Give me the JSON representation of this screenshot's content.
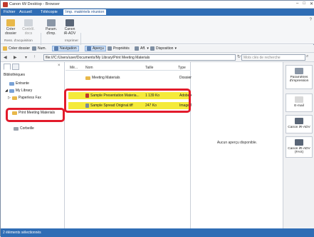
{
  "window": {
    "title": "Canon iW Desktop - Browser"
  },
  "menu": {
    "items": [
      "Fichier",
      "Accueil",
      "Télécopie"
    ],
    "active": "Imp. matériels réunion"
  },
  "ribbon": {
    "create_folder": "Créer dossier",
    "check_docs": "Contrôl. docs",
    "group1": "Ress. d'acquisition",
    "print_settings": "Param. d'imp.",
    "canon_printer": "Canon iR-ADV",
    "group2": "Imprimer"
  },
  "toolbar": {
    "create_folder": "Créer dossier",
    "num": "Num.",
    "navigation": "Navigation",
    "preview": "Aperçu",
    "properties": "Propriétés",
    "display": "Aff.",
    "layout": "Disposition"
  },
  "address": {
    "path": "file:///C:/Users/user/Documents/My Library/Print Meeting Materials",
    "search_placeholder": "Mots clés de recherche"
  },
  "tree": {
    "heading": "Bibliothèques",
    "items": [
      "Entrante",
      "My Library",
      "Paperless Fax",
      "Print Meeting Materials",
      "Corbeille"
    ]
  },
  "columns": {
    "m": "Mé...",
    "name": "Nom",
    "size": "Taille",
    "type": "Type"
  },
  "files": [
    {
      "name": "Meeting Materials",
      "size": "",
      "type": "Dossier"
    },
    {
      "name": "Sample Presentation Materia...",
      "size": "1 139 Ko",
      "type": "Adobe Acrobat"
    },
    {
      "name": "Sample Spread Original.tiff",
      "size": "247 Ko",
      "type": "Image TIFF"
    }
  ],
  "preview": {
    "message": "Aucun aperçu disponible."
  },
  "right_panel": [
    "Paramètres d'impression",
    "E-mail",
    "Canon iR-ADV",
    "Canon iR-ADV (FAX)"
  ],
  "status": {
    "text": "2 éléments sélectionnés"
  },
  "colors": {
    "accent": "#2f6db5",
    "highlight": "#e21b2b",
    "selection": "#f4ea3a"
  }
}
